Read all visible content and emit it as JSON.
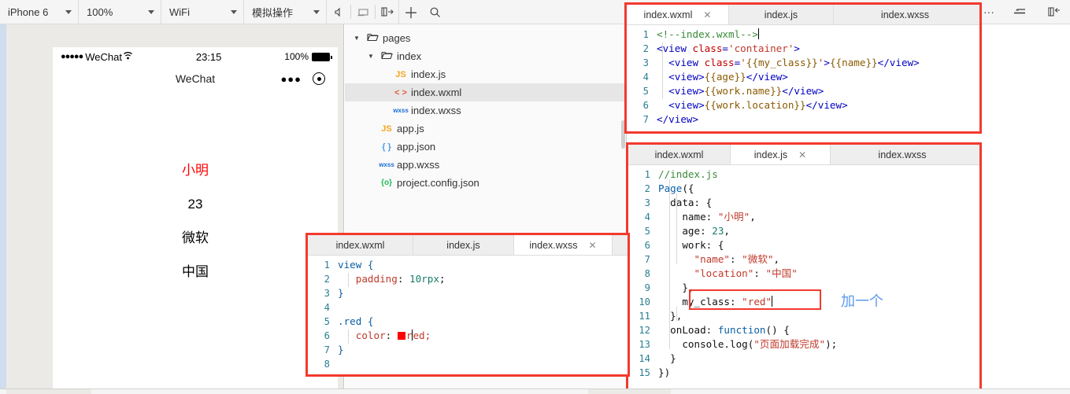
{
  "toolbar": {
    "selects": [
      {
        "label": "iPhone 6",
        "name": "device-select"
      },
      {
        "label": "100%",
        "name": "zoom-select"
      },
      {
        "label": "WiFi",
        "name": "network-select"
      },
      {
        "label": "模拟操作",
        "name": "simulate-select"
      }
    ],
    "icons": [
      {
        "glyph": "◁",
        "name": "volume-icon"
      },
      {
        "glyph": "▭",
        "name": "screen-icon"
      },
      {
        "glyph": "◨→",
        "name": "panel-right-icon"
      },
      {
        "glyph": "+",
        "name": "add-icon"
      },
      {
        "glyph": "⌕",
        "name": "search-icon"
      },
      {
        "glyph": "···",
        "name": "more-icon"
      },
      {
        "glyph": "≛",
        "name": "compile-icon"
      },
      {
        "glyph": "◨←",
        "name": "panel-left-icon"
      }
    ]
  },
  "simulator": {
    "status": {
      "signal": "●●●●●",
      "carrier": "WeChat",
      "wifi": "⌃",
      "time": "23:15",
      "battery_percent": "100%"
    },
    "navbar": {
      "title": "WeChat",
      "more": "●●●",
      "target": "◉"
    },
    "page_values": [
      {
        "text": "小明",
        "color": "#ff0000"
      },
      {
        "text": "23",
        "color": "#000000"
      },
      {
        "text": "微软",
        "color": "#000000"
      },
      {
        "text": "中国",
        "color": "#000000"
      }
    ]
  },
  "file_tree": [
    {
      "indent": 0,
      "arrow": "▼",
      "icon": "folder-open-icon",
      "icon_text": "🗁",
      "label": "pages",
      "selected": false
    },
    {
      "indent": 1,
      "arrow": "▼",
      "icon": "folder-open-icon",
      "icon_text": "🗁",
      "label": "index",
      "selected": false
    },
    {
      "indent": 2,
      "arrow": "",
      "icon": "js-file-icon",
      "icon_text": "JS",
      "label": "index.js",
      "selected": false
    },
    {
      "indent": 2,
      "arrow": "",
      "icon": "wxml-file-icon",
      "icon_text": "< >",
      "label": "index.wxml",
      "selected": true
    },
    {
      "indent": 2,
      "arrow": "",
      "icon": "wxss-file-icon",
      "icon_text": "wxss",
      "label": "index.wxss",
      "selected": false
    },
    {
      "indent": 1,
      "arrow": "",
      "icon": "js-file-icon",
      "icon_text": "JS",
      "label": "app.js",
      "selected": false
    },
    {
      "indent": 1,
      "arrow": "",
      "icon": "json-file-icon",
      "icon_text": "{ }",
      "label": "app.json",
      "selected": false
    },
    {
      "indent": 1,
      "arrow": "",
      "icon": "wxss-file-icon",
      "icon_text": "wxss",
      "label": "app.wxss",
      "selected": false
    },
    {
      "indent": 1,
      "arrow": "",
      "icon": "config-file-icon",
      "icon_text": "{o}",
      "label": "project.config.json",
      "selected": false
    }
  ],
  "panels": {
    "wxml": {
      "tabs": [
        {
          "label": "index.wxml",
          "active": true,
          "closable": true
        },
        {
          "label": "index.js",
          "active": false,
          "closable": false
        },
        {
          "label": "index.wxss",
          "active": false,
          "closable": false
        }
      ],
      "lines": [
        {
          "n": "1",
          "segs": [
            {
              "t": "<!--index.wxml-->",
              "c": "tok-cmt"
            }
          ],
          "caret": true
        },
        {
          "n": "2",
          "segs": [
            {
              "t": "<view ",
              "c": "tok-tag"
            },
            {
              "t": "class",
              "c": "tok-attr"
            },
            {
              "t": "=",
              "c": "tok-tag"
            },
            {
              "t": "'container'",
              "c": "tok-str"
            },
            {
              "t": ">",
              "c": "tok-tag"
            }
          ]
        },
        {
          "n": "3",
          "segs": [
            {
              "t": "  <view ",
              "c": "tok-tag"
            },
            {
              "t": "class",
              "c": "tok-attr"
            },
            {
              "t": "=",
              "c": "tok-tag"
            },
            {
              "t": "'",
              "c": "tok-str"
            },
            {
              "t": "{{my_class}}",
              "c": "tok-brace"
            },
            {
              "t": "'",
              "c": "tok-str"
            },
            {
              "t": ">",
              "c": "tok-tag"
            },
            {
              "t": "{{name}}",
              "c": "tok-brace"
            },
            {
              "t": "</view>",
              "c": "tok-tag"
            }
          ]
        },
        {
          "n": "4",
          "segs": [
            {
              "t": "  <view>",
              "c": "tok-tag"
            },
            {
              "t": "{{age}}",
              "c": "tok-brace"
            },
            {
              "t": "</view>",
              "c": "tok-tag"
            }
          ]
        },
        {
          "n": "5",
          "segs": [
            {
              "t": "  <view>",
              "c": "tok-tag"
            },
            {
              "t": "{{work.name}}",
              "c": "tok-brace"
            },
            {
              "t": "</view>",
              "c": "tok-tag"
            }
          ]
        },
        {
          "n": "6",
          "segs": [
            {
              "t": "  <view>",
              "c": "tok-tag"
            },
            {
              "t": "{{work.location}}",
              "c": "tok-brace"
            },
            {
              "t": "</view>",
              "c": "tok-tag"
            }
          ]
        },
        {
          "n": "7",
          "segs": [
            {
              "t": "</view>",
              "c": "tok-tag"
            }
          ]
        }
      ]
    },
    "js": {
      "tabs": [
        {
          "label": "index.wxml",
          "active": false,
          "closable": false
        },
        {
          "label": "index.js",
          "active": true,
          "closable": true
        },
        {
          "label": "index.wxss",
          "active": false,
          "closable": false
        }
      ],
      "lines": [
        {
          "n": "1",
          "segs": [
            {
              "t": "//index.js",
              "c": "tok-cmt"
            }
          ]
        },
        {
          "n": "2",
          "segs": [
            {
              "t": "Page",
              "c": "tok-kw"
            },
            {
              "t": "({",
              "c": "tok-plain"
            }
          ]
        },
        {
          "n": "3",
          "segs": [
            {
              "t": "  data: {",
              "c": "tok-plain"
            }
          ]
        },
        {
          "n": "4",
          "segs": [
            {
              "t": "    name: ",
              "c": "tok-plain"
            },
            {
              "t": "\"小明\"",
              "c": "tok-str"
            },
            {
              "t": ",",
              "c": "tok-plain"
            }
          ]
        },
        {
          "n": "5",
          "segs": [
            {
              "t": "    age: ",
              "c": "tok-plain"
            },
            {
              "t": "23",
              "c": "tok-num"
            },
            {
              "t": ",",
              "c": "tok-plain"
            }
          ]
        },
        {
          "n": "6",
          "segs": [
            {
              "t": "    work: {",
              "c": "tok-plain"
            }
          ]
        },
        {
          "n": "7",
          "segs": [
            {
              "t": "      ",
              "c": "tok-plain"
            },
            {
              "t": "\"name\"",
              "c": "tok-str"
            },
            {
              "t": ": ",
              "c": "tok-plain"
            },
            {
              "t": "\"微软\"",
              "c": "tok-str"
            },
            {
              "t": ",",
              "c": "tok-plain"
            }
          ]
        },
        {
          "n": "8",
          "segs": [
            {
              "t": "      ",
              "c": "tok-plain"
            },
            {
              "t": "\"location\"",
              "c": "tok-str"
            },
            {
              "t": ": ",
              "c": "tok-plain"
            },
            {
              "t": "\"中国\"",
              "c": "tok-str"
            }
          ]
        },
        {
          "n": "9",
          "segs": [
            {
              "t": "    },",
              "c": "tok-plain"
            }
          ]
        },
        {
          "n": "10",
          "segs": [
            {
              "t": "    my_class: ",
              "c": "tok-plain"
            },
            {
              "t": "\"red\"",
              "c": "tok-str"
            }
          ],
          "caret": true
        },
        {
          "n": "11",
          "segs": [
            {
              "t": "  },",
              "c": "tok-plain"
            }
          ]
        },
        {
          "n": "12",
          "segs": [
            {
              "t": "  onLoad: ",
              "c": "tok-plain"
            },
            {
              "t": "function",
              "c": "tok-kw"
            },
            {
              "t": "() {",
              "c": "tok-plain"
            }
          ]
        },
        {
          "n": "13",
          "segs": [
            {
              "t": "    console.log(",
              "c": "tok-plain"
            },
            {
              "t": "\"页面加载完成\"",
              "c": "tok-str"
            },
            {
              "t": ");",
              "c": "tok-plain"
            }
          ]
        },
        {
          "n": "14",
          "segs": [
            {
              "t": "  }",
              "c": "tok-plain"
            }
          ]
        },
        {
          "n": "15",
          "segs": [
            {
              "t": "})",
              "c": "tok-plain"
            }
          ]
        }
      ],
      "annotation": "加一个",
      "annotation_color": "#5b9bf0",
      "highlight_line": "10"
    },
    "wxss": {
      "tabs": [
        {
          "label": "index.wxml",
          "active": false,
          "closable": false
        },
        {
          "label": "index.js",
          "active": false,
          "closable": false
        },
        {
          "label": "index.wxss",
          "active": true,
          "closable": true
        }
      ],
      "lines": [
        {
          "n": "1",
          "segs": [
            {
              "t": "view {",
              "c": "tok-sel"
            }
          ],
          "fold": true
        },
        {
          "n": "2",
          "segs": [
            {
              "t": "   ",
              "c": "tok-plain"
            },
            {
              "t": "padding",
              "c": "tok-prop"
            },
            {
              "t": ": ",
              "c": "tok-plain"
            },
            {
              "t": "10rpx",
              "c": "tok-num"
            },
            {
              "t": ";",
              "c": "tok-plain"
            }
          ]
        },
        {
          "n": "3",
          "segs": [
            {
              "t": "}",
              "c": "tok-sel"
            }
          ]
        },
        {
          "n": "4",
          "segs": [
            {
              "t": "",
              "c": "tok-plain"
            }
          ]
        },
        {
          "n": "5",
          "segs": [
            {
              "t": ".red {",
              "c": "tok-sel"
            }
          ],
          "fold": true
        },
        {
          "n": "6",
          "segs": [
            {
              "t": "   ",
              "c": "tok-plain"
            },
            {
              "t": "color",
              "c": "tok-prop"
            },
            {
              "t": ": ",
              "c": "tok-plain"
            }
          ],
          "swatch": "#ff0000",
          "after": "red;",
          "after_class": "tok-prop",
          "caret_in_after": 1
        },
        {
          "n": "7",
          "segs": [
            {
              "t": "}",
              "c": "tok-sel"
            }
          ]
        },
        {
          "n": "8",
          "segs": [
            {
              "t": "",
              "c": "tok-plain"
            }
          ]
        }
      ]
    }
  }
}
